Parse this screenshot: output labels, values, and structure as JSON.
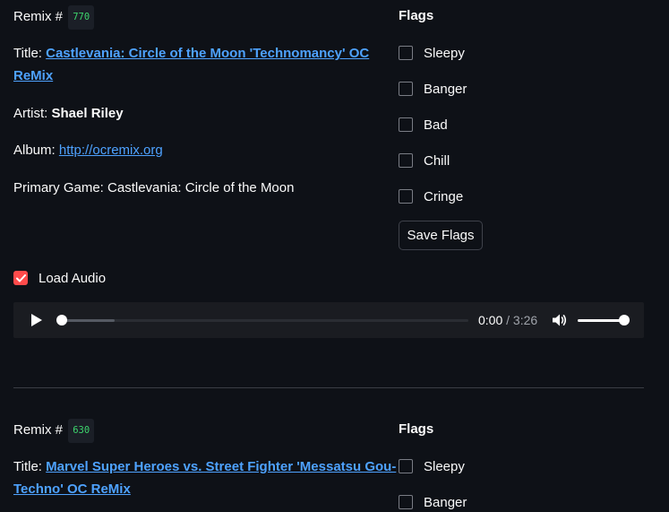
{
  "remixes": [
    {
      "number_label": "Remix #",
      "number": "770",
      "title_label": "Title:",
      "title_line1": "Castlevania: Circle of the Moon 'Technomancy' OC",
      "title_line2": "ReMix",
      "artist_label": "Artist:",
      "artist": "Shael Riley",
      "album_label": "Album:",
      "album": "http://ocremix.org",
      "game_label": "Primary Game:",
      "game": "Castlevania: Circle of the Moon",
      "flags_title": "Flags",
      "flags": [
        "Sleepy",
        "Banger",
        "Bad",
        "Chill",
        "Cringe"
      ],
      "save_label": "Save Flags",
      "load_audio_label": "Load Audio",
      "player": {
        "current": "0:00",
        "separator": " / ",
        "duration": "3:26",
        "progress": 0.0,
        "buffered": 0.13,
        "volume": 1.0
      }
    },
    {
      "number_label": "Remix #",
      "number": "630",
      "title_label": "Title:",
      "title_line1": "Marvel Super Heroes vs. Street Fighter 'Messatsu Gou-",
      "title_line2": "Techno' OC ReMix",
      "flags_title": "Flags",
      "flags": [
        "Sleepy",
        "Banger"
      ]
    }
  ],
  "colors": {
    "background": "#0e1117",
    "link": "#4ea2ff",
    "accent": "#ff4b4b",
    "code": "#3dd56d"
  },
  "icons": {
    "play": "play-icon",
    "volume": "volume-icon",
    "check": "check-icon"
  }
}
